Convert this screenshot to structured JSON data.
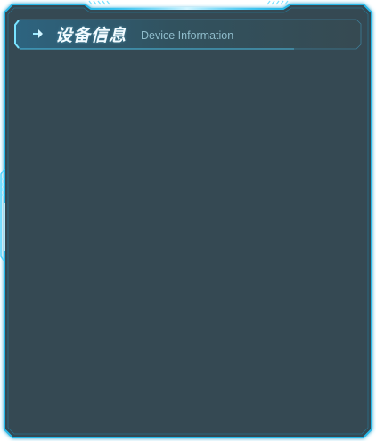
{
  "panel": {
    "title": "设备信息",
    "subtitle": "Device Information"
  },
  "icons": {
    "header": "chevron-right-arrow-icon"
  },
  "colors": {
    "panel_background": "#364a52",
    "frame_glow": "#27b8e8",
    "frame_line": "#56d8ff",
    "header_background": "#2f4a57",
    "title_text": "#f2fbff",
    "subtitle_text": "#8fbccb"
  }
}
